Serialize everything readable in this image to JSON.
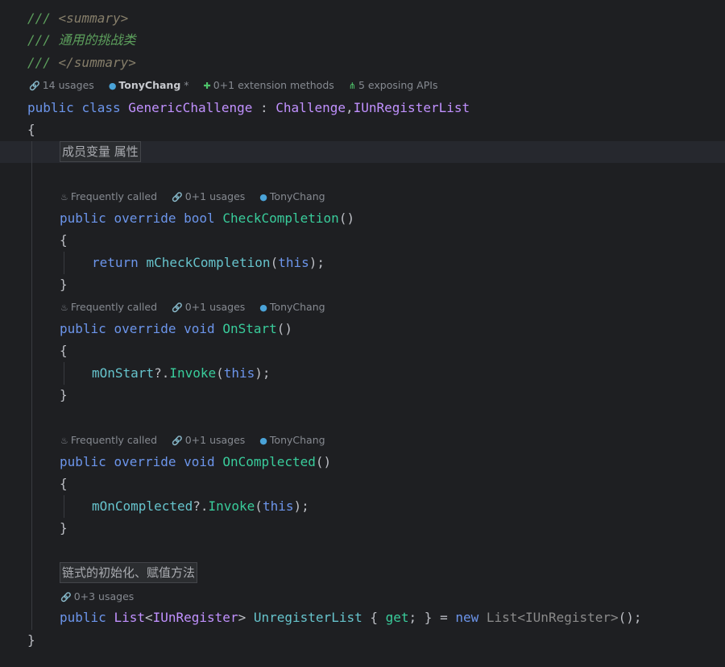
{
  "doc": {
    "c1": "/// ",
    "c1_tag": "<summary>",
    "c2": "/// 通用的挑战类",
    "c3": "/// ",
    "c3_tag": "</summary>"
  },
  "class_hints": {
    "usages": "14 usages",
    "author": "TonyChang",
    "author_suffix": " *",
    "extensions": "0+1 extension methods",
    "exposing": "5 exposing APIs"
  },
  "class_decl": {
    "kw1": "public",
    "kw2": "class",
    "name": "GenericChallenge",
    "colon": " : ",
    "base": "Challenge",
    "comma": ",",
    "iface": "IUnRegisterList"
  },
  "braces": {
    "open": "{",
    "close": "}"
  },
  "region1": "成员变量 属性",
  "region2": "链式的初始化、赋值方法",
  "methods": [
    {
      "hint_freq": "Frequently called",
      "hint_usages": "0+1 usages",
      "hint_author": "TonyChang",
      "kw1": "public",
      "kw2": "override",
      "type": "bool",
      "name": "CheckCompletion",
      "params": "()",
      "body_kw": "return ",
      "body_call": "mCheckCompletion",
      "body_open": "(",
      "body_this": "this",
      "body_close": ");"
    },
    {
      "hint_freq": "Frequently called",
      "hint_usages": "0+1 usages",
      "hint_author": "TonyChang",
      "kw1": "public",
      "kw2": "override",
      "type": "void",
      "name": "OnStart",
      "params": "()",
      "body_field": "mOnStart",
      "body_op": "?.",
      "body_call": "Invoke",
      "body_open": "(",
      "body_this": "this",
      "body_close": ");"
    },
    {
      "hint_freq": "Frequently called",
      "hint_usages": "0+1 usages",
      "hint_author": "TonyChang",
      "kw1": "public",
      "kw2": "override",
      "type": "void",
      "name": "OnComplected",
      "params": "()",
      "body_field": "mOnComplected",
      "body_op": "?.",
      "body_call": "Invoke",
      "body_open": "(",
      "body_this": "this",
      "body_close": ");"
    }
  ],
  "prop": {
    "hint_usages": "0+3 usages",
    "kw1": "public",
    "type1": "List",
    "lt": "<",
    "type_arg": "IUnRegister",
    "gt": ">",
    "name": "UnregisterList",
    "acc_open": " { ",
    "get": "get",
    "acc_close": "; } = ",
    "new": "new",
    "type2": "List<IUnRegister>",
    "end": "();"
  }
}
